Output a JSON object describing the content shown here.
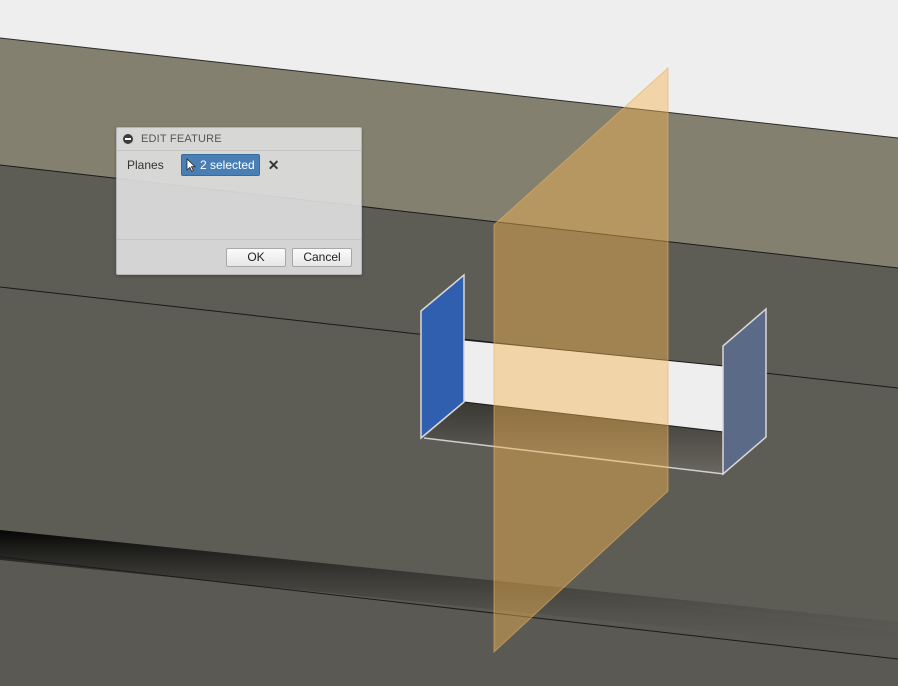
{
  "dialog": {
    "title": "EDIT FEATURE",
    "planes_label": "Planes",
    "selection_text": "2 selected",
    "clear_symbol": "✕",
    "ok_label": "OK",
    "cancel_label": "Cancel"
  },
  "icons": {
    "collapse": "collapse-circle-icon",
    "cursor": "arrow-cursor-icon",
    "clear": "close-icon"
  },
  "colors": {
    "background": "#eeeeee",
    "model_face": "#5d5c55",
    "upper_face": "#84806f",
    "selected_plane_left": "#2f5fae",
    "selected_plane_right": "#5a6a87",
    "construction_plane": "#f2c070",
    "selection_chip": "#4a7fb5"
  }
}
